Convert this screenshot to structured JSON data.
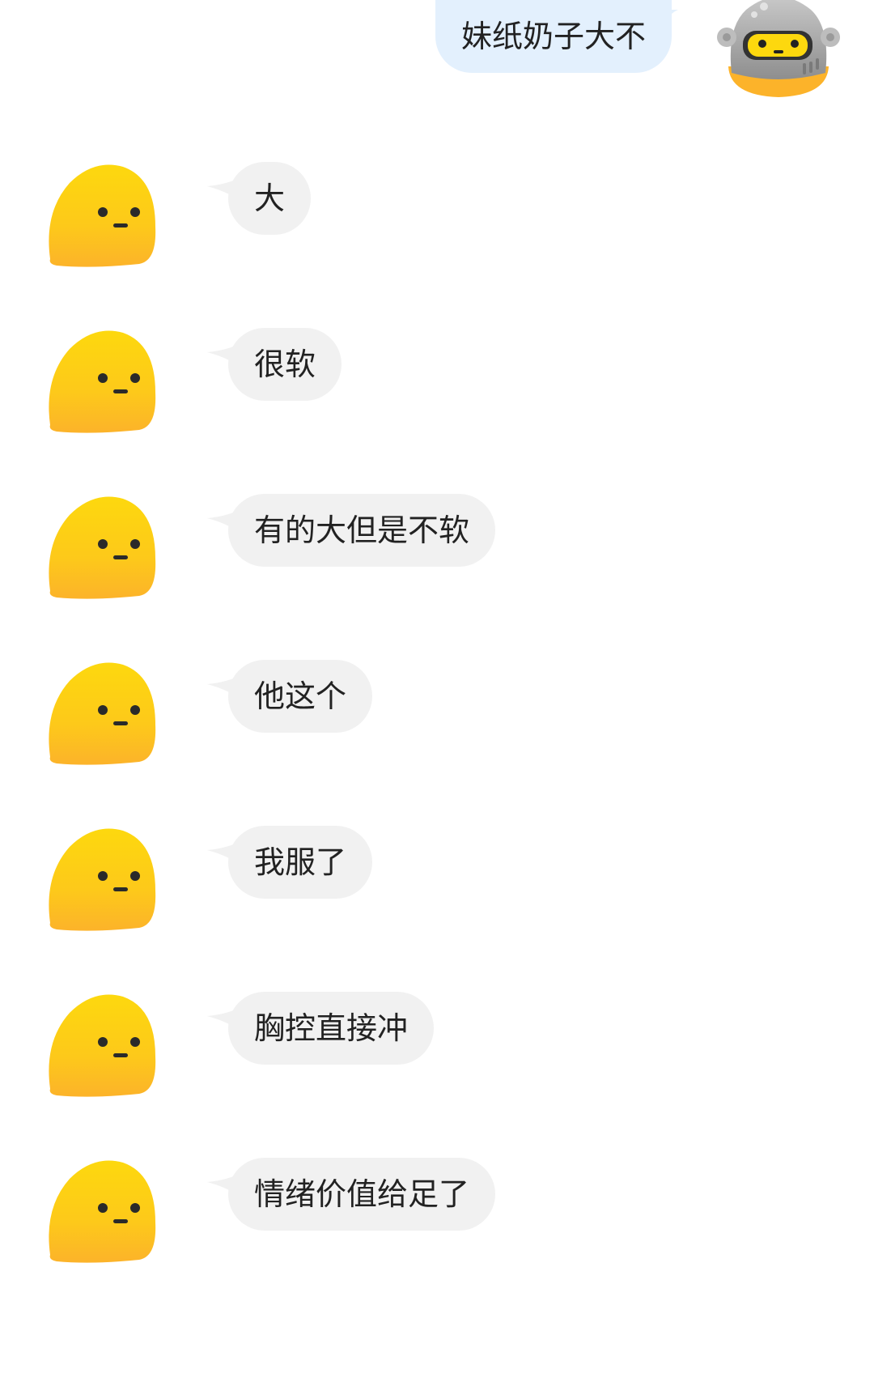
{
  "colors": {
    "outgoing_bubble": "#e3f0fd",
    "incoming_bubble": "#f1f1f1",
    "text": "#222222",
    "avatar_yellow_top": "#fdd80e",
    "avatar_yellow_bottom": "#fcb32a",
    "robot_gray": "#a9a9a9"
  },
  "outgoing": {
    "text": "妹纸奶子大不",
    "avatar_icon": "robot-avatar-icon"
  },
  "incoming": [
    {
      "text": "大",
      "avatar_icon": "yellow-blob-avatar-icon"
    },
    {
      "text": "很软",
      "avatar_icon": "yellow-blob-avatar-icon"
    },
    {
      "text": "有的大但是不软",
      "avatar_icon": "yellow-blob-avatar-icon"
    },
    {
      "text": "他这个",
      "avatar_icon": "yellow-blob-avatar-icon"
    },
    {
      "text": "我服了",
      "avatar_icon": "yellow-blob-avatar-icon"
    },
    {
      "text": "胸控直接冲",
      "avatar_icon": "yellow-blob-avatar-icon"
    },
    {
      "text": "情绪价值给足了",
      "avatar_icon": "yellow-blob-avatar-icon"
    }
  ]
}
